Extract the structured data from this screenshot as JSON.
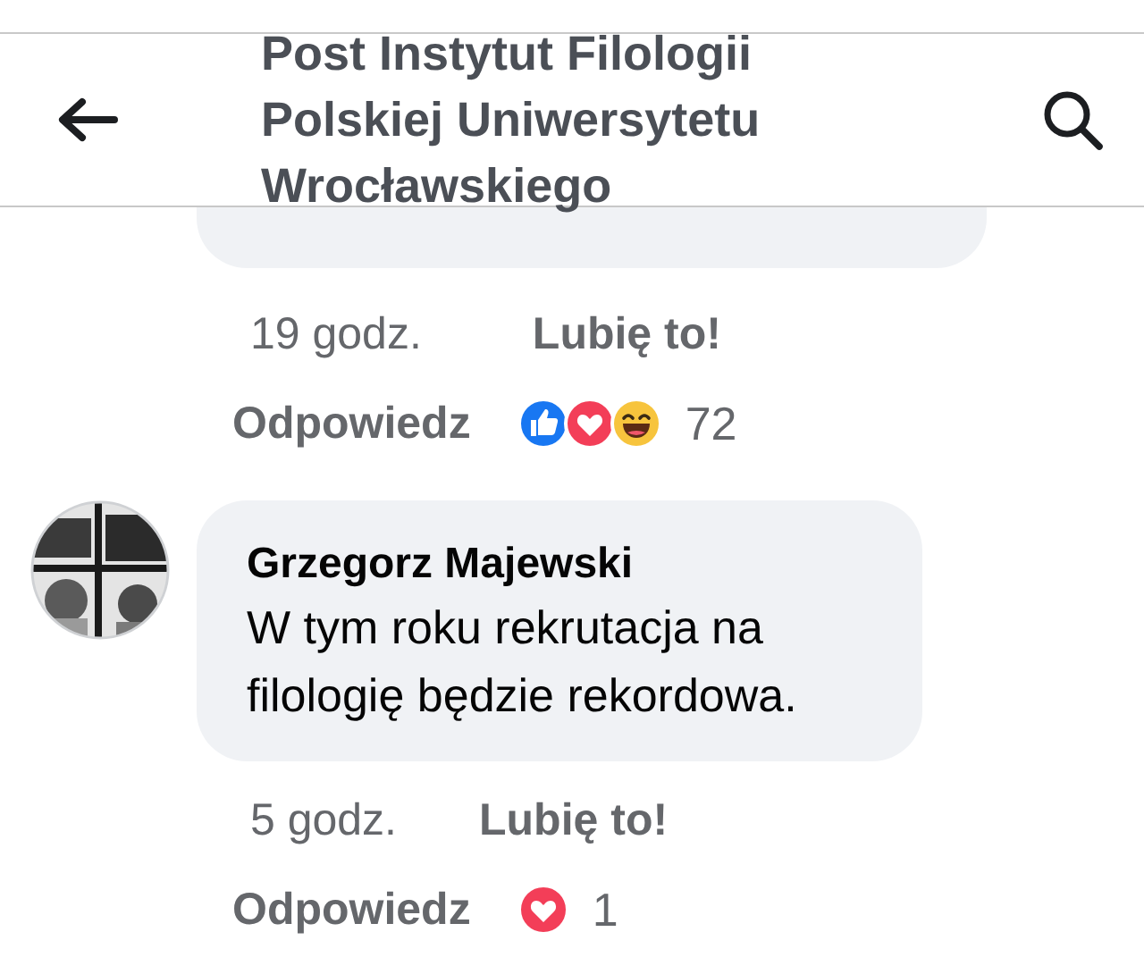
{
  "header": {
    "title": "Post Instytut Filologii Polskiej Uniwersytetu Wrocławskiego"
  },
  "comments": [
    {
      "time": "19 godz.",
      "like": "Lubię to!",
      "reply": "Odpowiedz",
      "reactions": [
        {
          "kind": "like"
        },
        {
          "kind": "love"
        },
        {
          "kind": "haha"
        }
      ],
      "count": "72"
    },
    {
      "avatar": {
        "kind": "picture"
      },
      "author": "Grzegorz Majewski",
      "text": "W tym roku rekrutacja na filologię będzie rekordowa.",
      "time": "5 godz.",
      "like": "Lubię to!",
      "reply": "Odpowiedz",
      "reactions": [
        {
          "kind": "love"
        }
      ],
      "count": "1"
    }
  ]
}
